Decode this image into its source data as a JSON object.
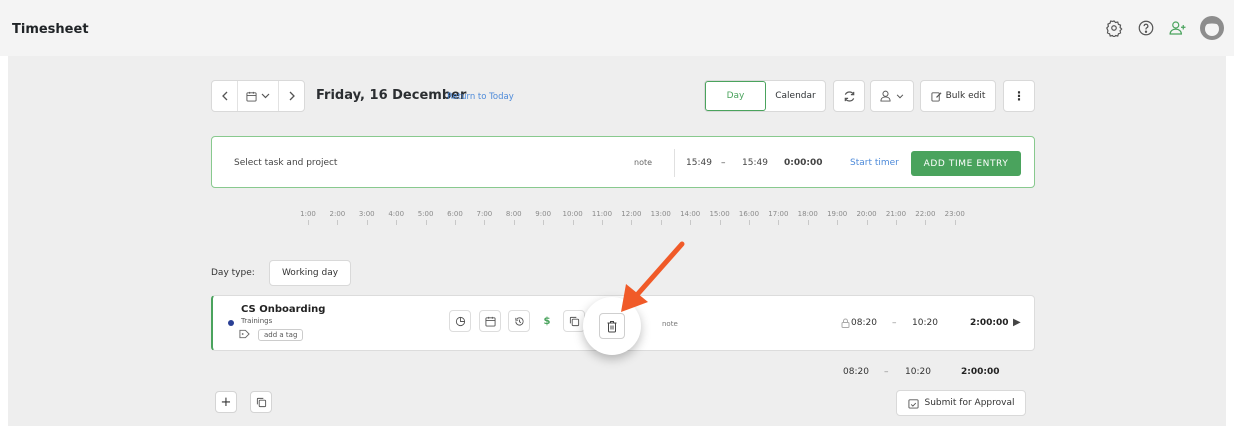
{
  "header": {
    "title": "Timesheet"
  },
  "toolbar": {
    "date": "Friday, 16 December",
    "return_link": "Return to Today",
    "view_day": "Day",
    "view_calendar": "Calendar",
    "bulk_edit": "Bulk edit"
  },
  "entry_bar": {
    "task_placeholder": "Select task and project",
    "note": "note",
    "start": "15:49",
    "dash": "–",
    "end": "15:49",
    "duration": "0:00:00",
    "start_timer": "Start timer",
    "add_button": "ADD TIME ENTRY"
  },
  "timeline": {
    "hours": [
      "1:00",
      "2:00",
      "3:00",
      "4:00",
      "5:00",
      "6:00",
      "7:00",
      "8:00",
      "9:00",
      "10:00",
      "11:00",
      "12:00",
      "13:00",
      "14:00",
      "15:00",
      "16:00",
      "17:00",
      "18:00",
      "19:00",
      "20:00",
      "21:00",
      "22:00",
      "23:00"
    ]
  },
  "day_type": {
    "label": "Day type:",
    "value": "Working day"
  },
  "entry": {
    "task": "CS Onboarding",
    "project": "Trainings",
    "project_color": "#2a3f95",
    "tag_placeholder": "add a tag",
    "note": "note",
    "start": "08:20",
    "dash": "–",
    "end": "10:20",
    "duration": "2:00:00"
  },
  "totals": {
    "start": "08:20",
    "dash": "–",
    "end": "10:20",
    "duration": "2:00:00"
  },
  "footer": {
    "submit": "Submit for Approval"
  },
  "colors": {
    "accent_green": "#4aa35d",
    "link_blue": "#4d8ad9",
    "annotation_arrow": "#f05a28"
  }
}
